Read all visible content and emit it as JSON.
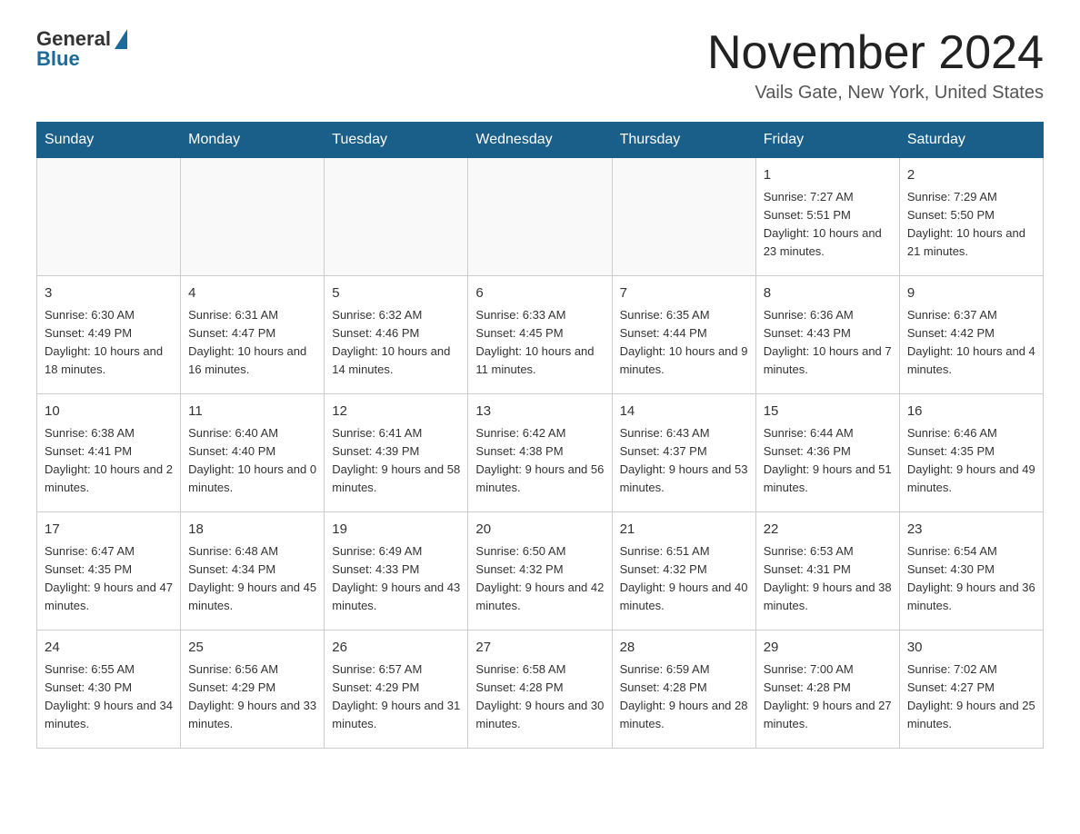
{
  "header": {
    "logo": {
      "general": "General",
      "blue": "Blue"
    },
    "title": "November 2024",
    "location": "Vails Gate, New York, United States"
  },
  "calendar": {
    "days_of_week": [
      "Sunday",
      "Monday",
      "Tuesday",
      "Wednesday",
      "Thursday",
      "Friday",
      "Saturday"
    ],
    "weeks": [
      [
        {
          "day": "",
          "info": ""
        },
        {
          "day": "",
          "info": ""
        },
        {
          "day": "",
          "info": ""
        },
        {
          "day": "",
          "info": ""
        },
        {
          "day": "",
          "info": ""
        },
        {
          "day": "1",
          "info": "Sunrise: 7:27 AM\nSunset: 5:51 PM\nDaylight: 10 hours and 23 minutes."
        },
        {
          "day": "2",
          "info": "Sunrise: 7:29 AM\nSunset: 5:50 PM\nDaylight: 10 hours and 21 minutes."
        }
      ],
      [
        {
          "day": "3",
          "info": "Sunrise: 6:30 AM\nSunset: 4:49 PM\nDaylight: 10 hours and 18 minutes."
        },
        {
          "day": "4",
          "info": "Sunrise: 6:31 AM\nSunset: 4:47 PM\nDaylight: 10 hours and 16 minutes."
        },
        {
          "day": "5",
          "info": "Sunrise: 6:32 AM\nSunset: 4:46 PM\nDaylight: 10 hours and 14 minutes."
        },
        {
          "day": "6",
          "info": "Sunrise: 6:33 AM\nSunset: 4:45 PM\nDaylight: 10 hours and 11 minutes."
        },
        {
          "day": "7",
          "info": "Sunrise: 6:35 AM\nSunset: 4:44 PM\nDaylight: 10 hours and 9 minutes."
        },
        {
          "day": "8",
          "info": "Sunrise: 6:36 AM\nSunset: 4:43 PM\nDaylight: 10 hours and 7 minutes."
        },
        {
          "day": "9",
          "info": "Sunrise: 6:37 AM\nSunset: 4:42 PM\nDaylight: 10 hours and 4 minutes."
        }
      ],
      [
        {
          "day": "10",
          "info": "Sunrise: 6:38 AM\nSunset: 4:41 PM\nDaylight: 10 hours and 2 minutes."
        },
        {
          "day": "11",
          "info": "Sunrise: 6:40 AM\nSunset: 4:40 PM\nDaylight: 10 hours and 0 minutes."
        },
        {
          "day": "12",
          "info": "Sunrise: 6:41 AM\nSunset: 4:39 PM\nDaylight: 9 hours and 58 minutes."
        },
        {
          "day": "13",
          "info": "Sunrise: 6:42 AM\nSunset: 4:38 PM\nDaylight: 9 hours and 56 minutes."
        },
        {
          "day": "14",
          "info": "Sunrise: 6:43 AM\nSunset: 4:37 PM\nDaylight: 9 hours and 53 minutes."
        },
        {
          "day": "15",
          "info": "Sunrise: 6:44 AM\nSunset: 4:36 PM\nDaylight: 9 hours and 51 minutes."
        },
        {
          "day": "16",
          "info": "Sunrise: 6:46 AM\nSunset: 4:35 PM\nDaylight: 9 hours and 49 minutes."
        }
      ],
      [
        {
          "day": "17",
          "info": "Sunrise: 6:47 AM\nSunset: 4:35 PM\nDaylight: 9 hours and 47 minutes."
        },
        {
          "day": "18",
          "info": "Sunrise: 6:48 AM\nSunset: 4:34 PM\nDaylight: 9 hours and 45 minutes."
        },
        {
          "day": "19",
          "info": "Sunrise: 6:49 AM\nSunset: 4:33 PM\nDaylight: 9 hours and 43 minutes."
        },
        {
          "day": "20",
          "info": "Sunrise: 6:50 AM\nSunset: 4:32 PM\nDaylight: 9 hours and 42 minutes."
        },
        {
          "day": "21",
          "info": "Sunrise: 6:51 AM\nSunset: 4:32 PM\nDaylight: 9 hours and 40 minutes."
        },
        {
          "day": "22",
          "info": "Sunrise: 6:53 AM\nSunset: 4:31 PM\nDaylight: 9 hours and 38 minutes."
        },
        {
          "day": "23",
          "info": "Sunrise: 6:54 AM\nSunset: 4:30 PM\nDaylight: 9 hours and 36 minutes."
        }
      ],
      [
        {
          "day": "24",
          "info": "Sunrise: 6:55 AM\nSunset: 4:30 PM\nDaylight: 9 hours and 34 minutes."
        },
        {
          "day": "25",
          "info": "Sunrise: 6:56 AM\nSunset: 4:29 PM\nDaylight: 9 hours and 33 minutes."
        },
        {
          "day": "26",
          "info": "Sunrise: 6:57 AM\nSunset: 4:29 PM\nDaylight: 9 hours and 31 minutes."
        },
        {
          "day": "27",
          "info": "Sunrise: 6:58 AM\nSunset: 4:28 PM\nDaylight: 9 hours and 30 minutes."
        },
        {
          "day": "28",
          "info": "Sunrise: 6:59 AM\nSunset: 4:28 PM\nDaylight: 9 hours and 28 minutes."
        },
        {
          "day": "29",
          "info": "Sunrise: 7:00 AM\nSunset: 4:28 PM\nDaylight: 9 hours and 27 minutes."
        },
        {
          "day": "30",
          "info": "Sunrise: 7:02 AM\nSunset: 4:27 PM\nDaylight: 9 hours and 25 minutes."
        }
      ]
    ]
  }
}
